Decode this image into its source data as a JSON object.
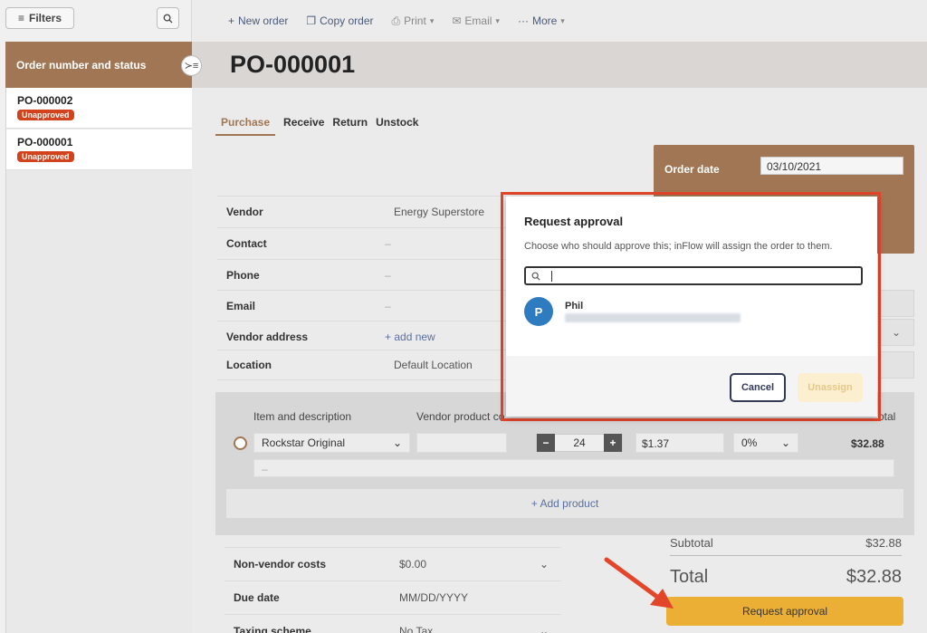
{
  "left": {
    "filters_label": "Filters",
    "list_header": "Order number and status",
    "orders": [
      {
        "number": "PO-000002",
        "status": "Unapproved"
      },
      {
        "number": "PO-000001",
        "status": "Unapproved"
      }
    ]
  },
  "toolbar": {
    "new_order": "New order",
    "copy_order": "Copy order",
    "print": "Print",
    "email": "Email",
    "more": "More"
  },
  "title": "PO-000001",
  "tabs": [
    "Purchase",
    "Receive",
    "Return",
    "Unstock"
  ],
  "order_date": {
    "label": "Order date",
    "value": "03/10/2021"
  },
  "vendor_form": [
    {
      "label": "Vendor",
      "value": "Energy Superstore"
    },
    {
      "label": "Contact",
      "value": "–"
    },
    {
      "label": "Phone",
      "value": "–"
    },
    {
      "label": "Email",
      "value": "–"
    },
    {
      "label": "Vendor address",
      "value": "+ add new"
    },
    {
      "label": "Location",
      "value": "Default Location"
    }
  ],
  "products": {
    "col_item": "Item and description",
    "col_vendor_code": "Vendor product co",
    "col_total": "otal",
    "item": "Rockstar Original",
    "quantity": "24",
    "price": "$1.37",
    "discount": "0%",
    "line_total": "$32.88",
    "description_placeholder": "–",
    "add_product": "+ Add product"
  },
  "lower_form": [
    {
      "label": "Non-vendor costs",
      "value": "$0.00"
    },
    {
      "label": "Due date",
      "value": "MM/DD/YYYY"
    },
    {
      "label": "Taxing scheme",
      "value": "No Tax"
    }
  ],
  "totals": {
    "subtotal_label": "Subtotal",
    "subtotal": "$32.88",
    "total_label": "Total",
    "total": "$32.88",
    "request_button": "Request approval"
  },
  "modal": {
    "title": "Request approval",
    "description": "Choose who should approve this; inFlow will assign the order to them.",
    "search_value": "",
    "user_initial": "P",
    "user_name": "Phil",
    "cancel": "Cancel",
    "unassign": "Unassign"
  },
  "colors": {
    "accent": "#a07654",
    "badge": "#d1421d",
    "button": "#ebaf35",
    "highlight": "#e3452a",
    "avatar": "#2f7bc0"
  }
}
